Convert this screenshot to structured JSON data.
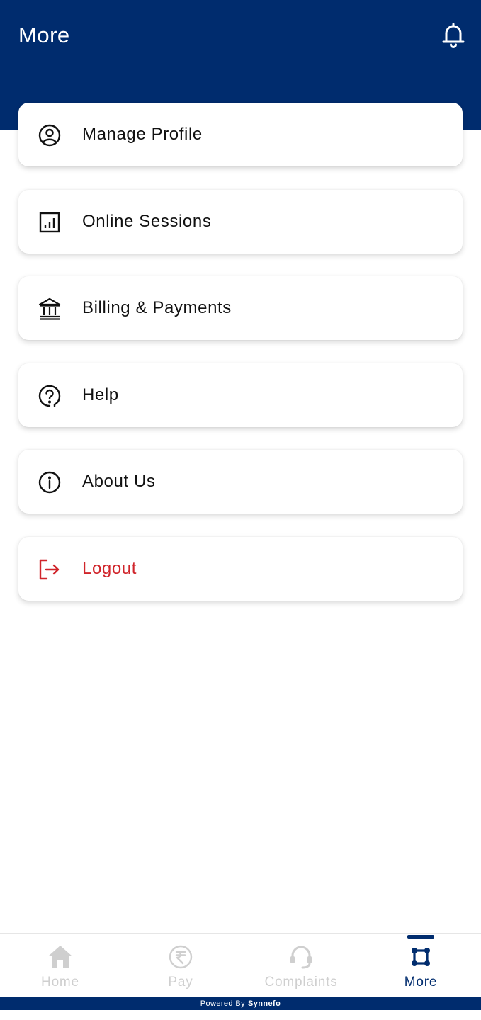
{
  "header": {
    "title": "More",
    "notification_icon": "bell-icon"
  },
  "menu": {
    "items": [
      {
        "label": "Manage Profile",
        "icon": "user-circle-icon"
      },
      {
        "label": "Online Sessions",
        "icon": "bar-chart-icon"
      },
      {
        "label": "Billing & Payments",
        "icon": "bank-icon"
      },
      {
        "label": "Help",
        "icon": "help-circle-icon"
      },
      {
        "label": "About Us",
        "icon": "info-icon"
      },
      {
        "label": "Logout",
        "icon": "logout-icon"
      }
    ]
  },
  "bottom_nav": {
    "items": [
      {
        "label": "Home",
        "icon": "home-icon"
      },
      {
        "label": "Pay",
        "icon": "rupee-icon"
      },
      {
        "label": "Complaints",
        "icon": "headset-icon"
      },
      {
        "label": "More",
        "icon": "more-grid-icon"
      }
    ],
    "active": "More"
  },
  "footer": {
    "powered_by": "Powered By",
    "brand": "Synnefo"
  },
  "colors": {
    "primary": "#002c6e",
    "logout": "#d0252b",
    "inactive_nav": "#cfcfcf"
  }
}
